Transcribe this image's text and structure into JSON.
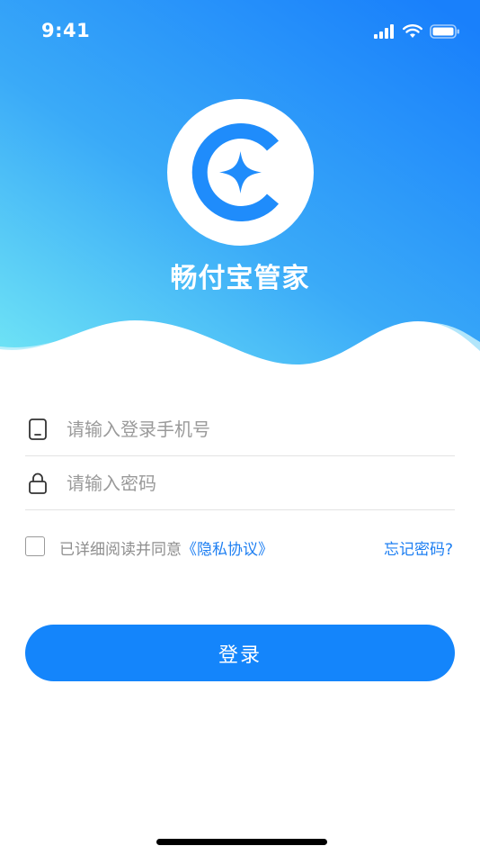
{
  "status_bar": {
    "time": "9:41"
  },
  "app": {
    "name": "畅付宝管家"
  },
  "form": {
    "phone_placeholder": "请输入登录手机号",
    "password_placeholder": "请输入密码"
  },
  "agreement": {
    "text": "已详细阅读并同意",
    "privacy_link": "《隐私协议》",
    "forgot_password": "忘记密码?"
  },
  "actions": {
    "login_label": "登录"
  },
  "colors": {
    "primary": "#1485fb",
    "link": "#1e7ff2",
    "gradient_top": "#1d82fb",
    "gradient_bottom": "#6ee4f5"
  }
}
